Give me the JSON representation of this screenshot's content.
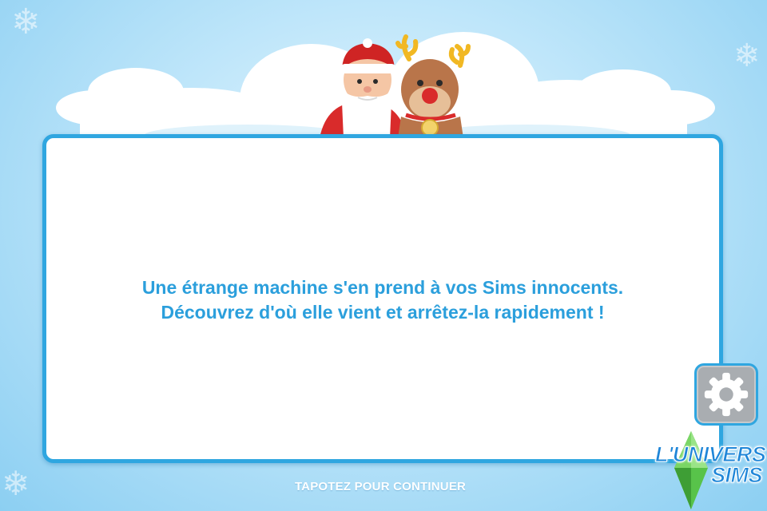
{
  "dialog": {
    "message_lines": [
      "Une étrange machine s'en prend à vos Sims innocents.",
      "Découvrez d'où elle vient et arrêtez-la rapidement !"
    ]
  },
  "footer": {
    "continue_hint": "TAPOTEZ POUR CONTINUER"
  },
  "settings": {
    "icon": "gear-icon"
  },
  "header": {
    "characters": [
      "santa-claus",
      "reindeer"
    ]
  },
  "watermark": {
    "line1": "L'UNIVERS",
    "line2": "SIMS",
    "icon": "plumbob-icon"
  },
  "colors": {
    "accent": "#2fa6e0",
    "message_text": "#2b9fdc",
    "background_light": "#eaf8ff",
    "background_dark": "#8ccff2",
    "settings_button": "#a9adb1"
  }
}
